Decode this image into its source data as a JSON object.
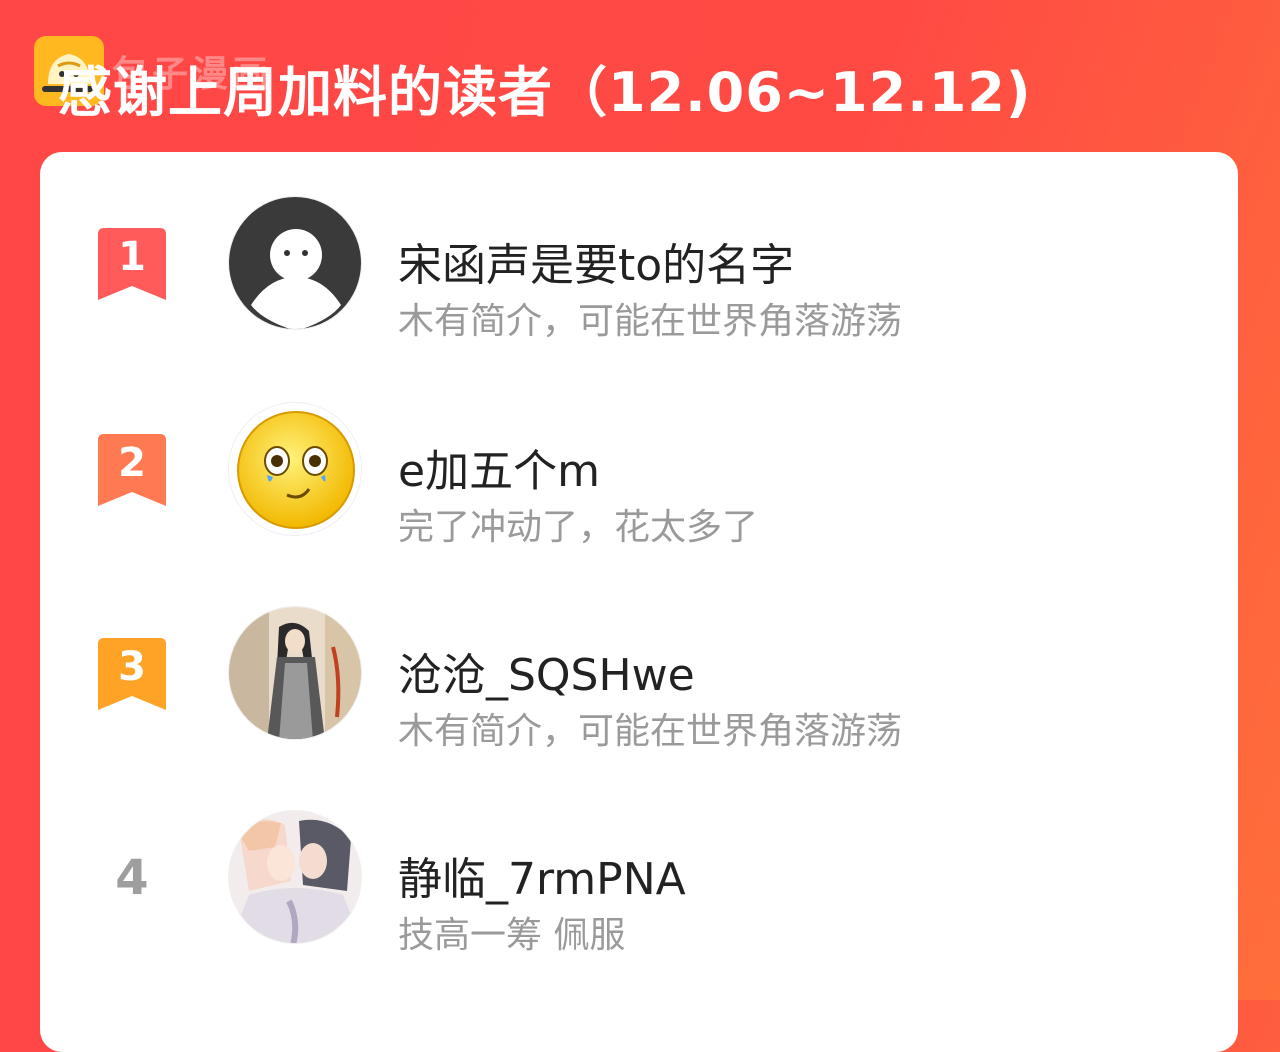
{
  "watermark": {
    "text": "包子漫画",
    "icon": "bun-logo-icon"
  },
  "header": {
    "title": "感谢上周加料的读者（12.06~12.12)"
  },
  "colors": {
    "background": "#ff4747",
    "card": "#ffffff",
    "rank1": "#ff5b5b",
    "rank2": "#ff7a52",
    "rank3": "#ffa326",
    "name_text": "#222222",
    "bio_text": "#9a9a9a"
  },
  "readers": [
    {
      "rank": "1",
      "name": "宋函声是要to的名字",
      "bio": "木有简介，可能在世界角落游荡",
      "avatar_icon": "default-ghost-avatar-icon"
    },
    {
      "rank": "2",
      "name": "e加五个m",
      "bio": "完了冲动了，花太多了",
      "avatar_icon": "teary-emoji-avatar-icon"
    },
    {
      "rank": "3",
      "name": "沧沧_SQSHwe",
      "bio": "木有简介，可能在世界角落游荡",
      "avatar_icon": "anime-character-avatar-icon"
    },
    {
      "rank": "4",
      "name": "静临_7rmPNA",
      "bio": "技高一筹 佩服",
      "avatar_icon": "anime-couple-avatar-icon"
    }
  ]
}
